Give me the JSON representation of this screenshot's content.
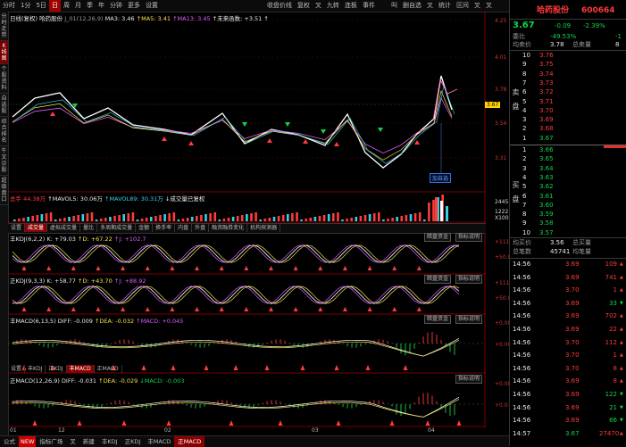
{
  "toolbar": {
    "items": [
      "分时",
      "1分",
      "5日",
      "日",
      "周",
      "月",
      "季",
      "年",
      "分钟",
      "更多",
      "设置"
    ],
    "active": 3,
    "mid_items": [
      "收盘价线",
      "复权",
      "叉",
      "九转",
      "连板",
      "事件"
    ],
    "right_items": [
      "叫",
      "删自选",
      "叉",
      "统计",
      "区间",
      "叉",
      "叉"
    ]
  },
  "vtabs": [
    {
      "label": "分时走势",
      "active": false
    },
    {
      "label": "K线图",
      "active": true
    },
    {
      "label": "个股资料",
      "active": false
    },
    {
      "label": "自选股",
      "active": false
    },
    {
      "label": "综合排名",
      "active": false
    },
    {
      "label": "牛叉诊股",
      "active": false
    },
    {
      "label": "超级盘口",
      "active": false
    }
  ],
  "kline": {
    "header": "日线(复权)",
    "name": "哈药股份",
    "params": "J_01(12,26,9)",
    "ma3": "MA3: 3.46",
    "ma5": "↑MA5: 3.41",
    "ma13": "↑MA13: 3.45",
    "ma_extra": "↑未来函数: +3.51 ↑",
    "price_scale": [
      "4.25",
      "4.01",
      "3.78",
      "3.67",
      "3.54",
      "3.31"
    ],
    "last_price_tag": "3.67",
    "add_tag": "加自选"
  },
  "volume": {
    "header_label": "总手",
    "total": "44.38万",
    "mavol5": "↑MAVOL5: 30.06万",
    "mavol89": "↑MAVOL89: 30.31万",
    "note": "↓成交量已复权",
    "scale": [
      "2445",
      "1222",
      "X1000"
    ]
  },
  "subtabs": {
    "items": [
      "设置",
      "成交量",
      "虚拟成交量",
      "量比",
      "多周期成交量",
      "金额",
      "换手率",
      "内盘",
      "外盘",
      "融资融券变化",
      "机构探测器"
    ],
    "active": 1
  },
  "kdj1": {
    "header": "丰KDJ(6,2,2) K: +79.03",
    "d": "↑D: +67.22",
    "j": "↑J: +102.7",
    "scale": [
      "+111.0",
      "+50.82"
    ],
    "tag1": "暗盘资金",
    "tag2": "指标说明"
  },
  "kdj2": {
    "header": "正KDJ(9,3,3) K: +58.77",
    "d": "↑D: +43.70",
    "j": "↑J: +88.92",
    "scale": [
      "+111.0",
      "+50.85"
    ],
    "tag1": "暗盘资金",
    "tag2": "指标说明"
  },
  "macd1": {
    "header": "丰MACD(6,13,5) DIFF: -0.009",
    "dea": "↑DEA: -0.032",
    "macd": "↑MACD: +0.045",
    "scale": [
      "+0.087",
      "+0.005"
    ],
    "tag1": "暗盘资金",
    "tag2": "指标说明",
    "tabs": [
      "设置",
      "丰KDJ",
      "正KDJ",
      "丰MACD",
      "正MACD"
    ],
    "active_tab": 3
  },
  "macd2": {
    "header": "正MACD(12,26,9) DIFF: -0.031",
    "dea": "↑DEA: -0.029",
    "macd": "↓MACD: -0.003",
    "scale": [
      "+0.087",
      "+0.011"
    ],
    "tag2": "指标说明"
  },
  "x_axis": [
    "01",
    "12",
    "02",
    "03",
    "04"
  ],
  "statusbar": {
    "items": [
      "公式",
      "NEW",
      "指标广场",
      "叉",
      "新建",
      "丰KDJ",
      "正KDJ",
      "丰MACD",
      "正MACD"
    ],
    "active": 8
  },
  "quote": {
    "name": "哈药股份",
    "code": "600664",
    "price": "3.67",
    "change": "-0.09",
    "pct": "-2.39%",
    "weibi_label": "委比",
    "weibi_val": "-49.53%",
    "weibi_val2": "-1",
    "junmai_label": "均卖价",
    "junmai_val": "3.78",
    "zongmai_label": "总卖量",
    "zongmai_val": "8",
    "sell_label": "卖盘",
    "buy_label": "买盘",
    "sells": [
      {
        "lv": "10",
        "p": "3.76",
        "v": ""
      },
      {
        "lv": "9",
        "p": "3.75",
        "v": ""
      },
      {
        "lv": "8",
        "p": "3.74",
        "v": ""
      },
      {
        "lv": "7",
        "p": "3.73",
        "v": ""
      },
      {
        "lv": "6",
        "p": "3.72",
        "v": ""
      },
      {
        "lv": "5",
        "p": "3.71",
        "v": ""
      },
      {
        "lv": "4",
        "p": "3.70",
        "v": ""
      },
      {
        "lv": "3",
        "p": "3.69",
        "v": ""
      },
      {
        "lv": "2",
        "p": "3.68",
        "v": ""
      },
      {
        "lv": "1",
        "p": "3.67",
        "v": ""
      }
    ],
    "buys": [
      {
        "lv": "1",
        "p": "3.66",
        "v": ""
      },
      {
        "lv": "2",
        "p": "3.65",
        "v": ""
      },
      {
        "lv": "3",
        "p": "3.64",
        "v": ""
      },
      {
        "lv": "4",
        "p": "3.63",
        "v": ""
      },
      {
        "lv": "5",
        "p": "3.62",
        "v": ""
      },
      {
        "lv": "6",
        "p": "3.61",
        "v": ""
      },
      {
        "lv": "7",
        "p": "3.60",
        "v": ""
      },
      {
        "lv": "8",
        "p": "3.59",
        "v": ""
      },
      {
        "lv": "9",
        "p": "3.58",
        "v": ""
      },
      {
        "lv": "10",
        "p": "3.57",
        "v": ""
      }
    ],
    "junmai2_label": "均买价",
    "junmai2_val": "3.56",
    "zongmai2_label": "总买量",
    "zongbi_label": "总笔数",
    "zongbi_val": "45741",
    "junbi_label": "均笔量",
    "trades": [
      {
        "t": "14:56",
        "p": "3.69",
        "v": "109",
        "d": "up"
      },
      {
        "t": "14:56",
        "p": "3.69",
        "v": "741",
        "d": "up"
      },
      {
        "t": "14:56",
        "p": "3.70",
        "v": "1",
        "d": "up"
      },
      {
        "t": "14:56",
        "p": "3.69",
        "v": "33",
        "d": "dn"
      },
      {
        "t": "14:56",
        "p": "3.69",
        "v": "702",
        "d": "up"
      },
      {
        "t": "14:56",
        "p": "3.69",
        "v": "22",
        "d": "up"
      },
      {
        "t": "14:56",
        "p": "3.70",
        "v": "112",
        "d": "up"
      },
      {
        "t": "14:56",
        "p": "3.70",
        "v": "1",
        "d": "up"
      },
      {
        "t": "14:56",
        "p": "3.70",
        "v": "8",
        "d": "up"
      },
      {
        "t": "14:56",
        "p": "3.69",
        "v": "8",
        "d": "up"
      },
      {
        "t": "14:56",
        "p": "3.69",
        "v": "122",
        "d": "dn"
      },
      {
        "t": "14:56",
        "p": "3.69",
        "v": "21",
        "d": "dn"
      },
      {
        "t": "14:56",
        "p": "3.69",
        "v": "66",
        "d": "dn"
      },
      {
        "t": "14:57",
        "p": "3.67",
        "v": "27470",
        "d": "up"
      }
    ]
  }
}
